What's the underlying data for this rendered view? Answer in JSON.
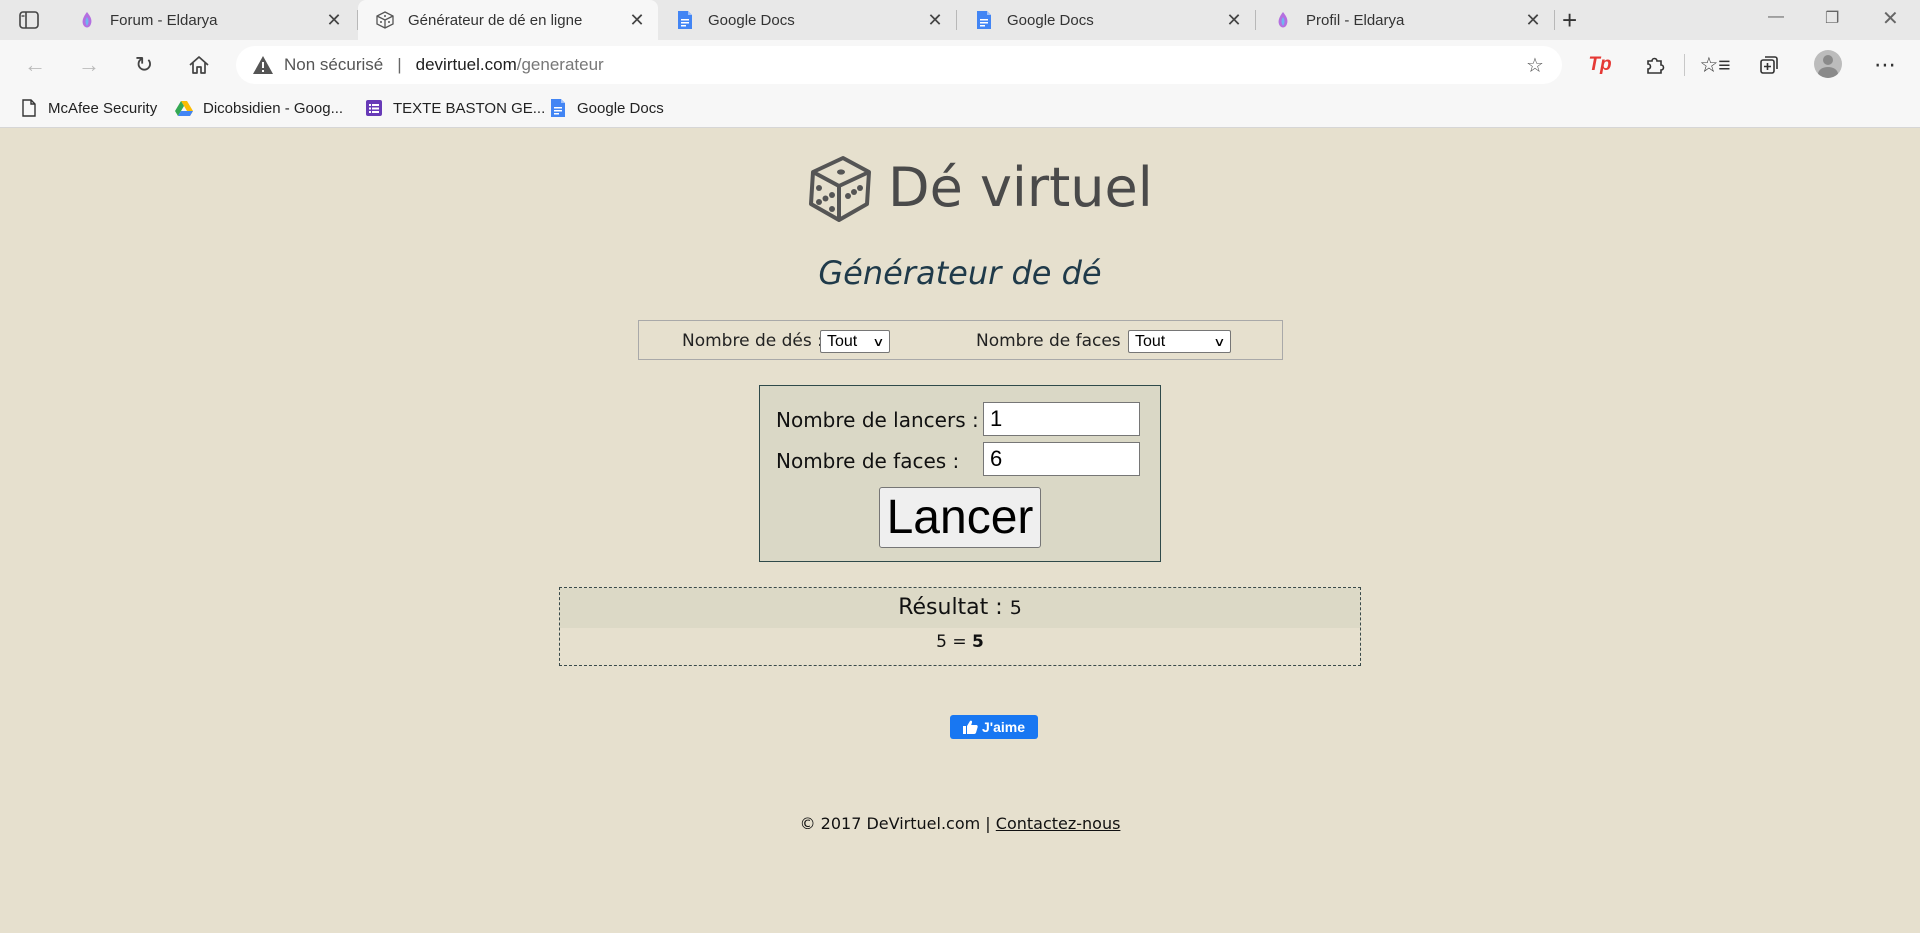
{
  "browser": {
    "tabs": [
      {
        "title": "Forum - Eldarya",
        "icon": "eldarya-icon"
      },
      {
        "title": "Générateur de dé en ligne",
        "icon": "dice-icon",
        "active": true
      },
      {
        "title": "Google Docs",
        "icon": "google-docs-icon"
      },
      {
        "title": "Google Docs",
        "icon": "google-docs-icon"
      },
      {
        "title": "Profil - Eldarya",
        "icon": "eldarya-icon"
      }
    ],
    "security_label": "Non sécurisé",
    "url_domain": "devirtuel.com",
    "url_path": "/generateur",
    "bookmarks": [
      {
        "label": "McAfee Security",
        "icon": "page-icon"
      },
      {
        "label": "Dicobsidien - Goog...",
        "icon": "google-drive-icon"
      },
      {
        "label": "TEXTE BASTON GE...",
        "icon": "forms-icon"
      },
      {
        "label": "Google Docs",
        "icon": "google-docs-icon"
      }
    ],
    "colors": {
      "accent_docs": "#4285f4",
      "extension_red": "#e53935"
    }
  },
  "page": {
    "site_title": "Dé virtuel",
    "subtitle": "Générateur de dé",
    "filters": {
      "dice_count_label": "Nombre de dés :",
      "dice_count_value": "Tout",
      "faces_label": "Nombre de faces :",
      "faces_value": "Tout"
    },
    "form": {
      "throws_label": "Nombre de lancers :",
      "throws_value": "1",
      "faces_label": "Nombre de faces :",
      "faces_value": "6",
      "submit_label": "Lancer"
    },
    "result": {
      "label": "Résultat :",
      "value": "5",
      "detail_expr": "5 =",
      "detail_total": "5"
    },
    "like_label": "J'aime",
    "footer": {
      "copyright": "© 2017 DeVirtuel.com |",
      "contact_label": "Contactez-nous"
    },
    "colors": {
      "background": "#e6e0ce",
      "panel": "#dad8c6",
      "like_blue": "#1877f2",
      "subtitle": "#1f3a4a"
    }
  }
}
